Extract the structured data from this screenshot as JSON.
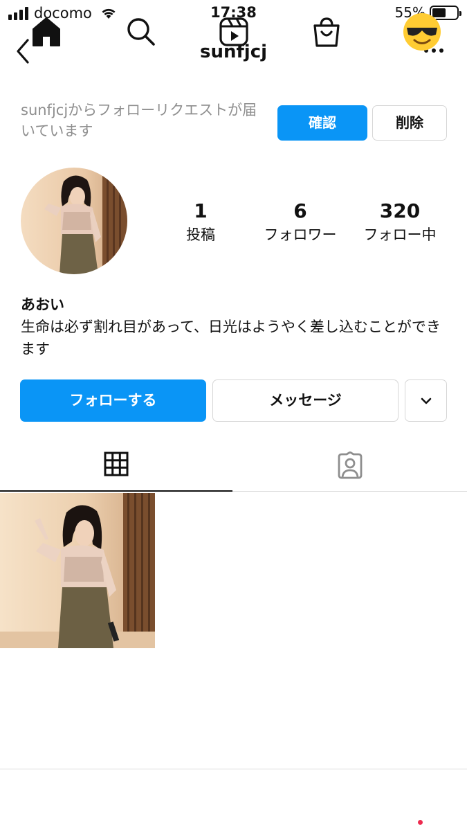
{
  "status_bar": {
    "carrier": "docomo",
    "time": "17:38",
    "battery_percent": "55%",
    "battery_level": 0.55
  },
  "nav": {
    "username": "sunfjcj",
    "back_icon": "chevron-left-icon",
    "more_icon": "more-horizontal-icon"
  },
  "follow_request": {
    "text": "sunfjcjからフォローリクエストが届いています",
    "confirm_label": "確認",
    "delete_label": "削除"
  },
  "profile": {
    "stats": [
      {
        "value": "1",
        "label": "投稿"
      },
      {
        "value": "6",
        "label": "フォロワー"
      },
      {
        "value": "320",
        "label": "フォロー中"
      }
    ],
    "display_name": "あおい",
    "bio": "生命は必ず割れ目があって、日光はようやく差し込むことができます"
  },
  "actions": {
    "follow_label": "フォローする",
    "message_label": "メッセージ",
    "dropdown_icon": "chevron-down-icon"
  },
  "tabs": [
    {
      "icon": "grid-icon",
      "active": true
    },
    {
      "icon": "tagged-person-icon",
      "active": false
    }
  ],
  "bottom_bar": [
    {
      "icon": "home-icon"
    },
    {
      "icon": "search-icon"
    },
    {
      "icon": "reels-icon"
    },
    {
      "icon": "shop-bag-icon"
    },
    {
      "icon": "profile-avatar-icon"
    }
  ],
  "colors": {
    "accent": "#0a95f6",
    "muted_text": "#8e8e8e",
    "border": "#dbdbdb",
    "notification_dot": "#ed2b4f"
  }
}
